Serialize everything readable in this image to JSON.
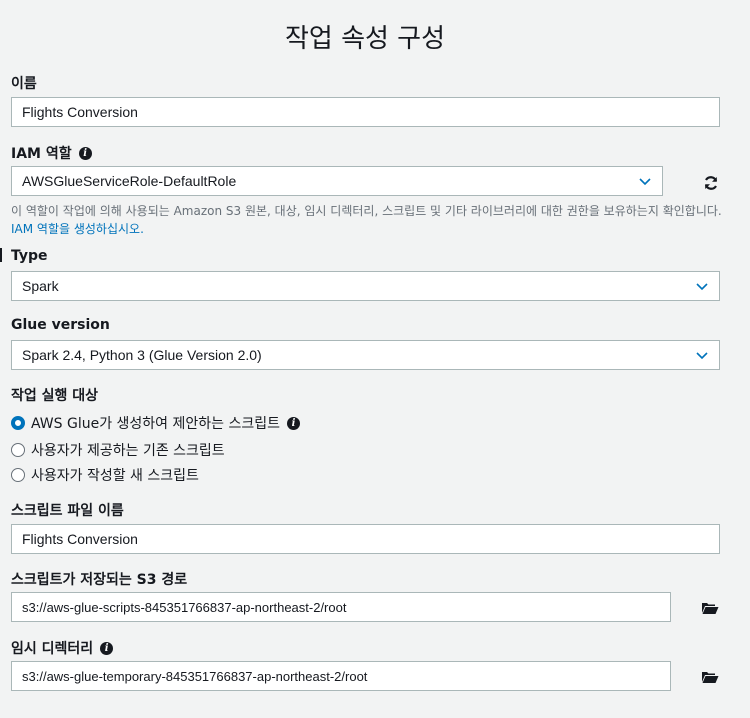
{
  "page": {
    "title": "작업 속성 구성"
  },
  "name": {
    "label": "이름",
    "value": "Flights Conversion"
  },
  "iam_role": {
    "label": "IAM 역할",
    "value": "AWSGlueServiceRole-DefaultRole",
    "help_text": "이 역할이 작업에 의해 사용되는 Amazon S3 원본, 대상, 임시 디렉터리, 스크립트 및 기타 라이브러리에 대한 권한을 보유하는지 확인합니다.",
    "help_link": "IAM 역할을 생성하십시오."
  },
  "type": {
    "label": "Type",
    "value": "Spark"
  },
  "glue_version": {
    "label": "Glue version",
    "value": "Spark 2.4, Python 3 (Glue Version 2.0)"
  },
  "run_target": {
    "label": "작업 실행 대상",
    "options": [
      {
        "label": "AWS Glue가 생성하여 제안하는 스크립트",
        "selected": true
      },
      {
        "label": "사용자가 제공하는 기존 스크립트",
        "selected": false
      },
      {
        "label": "사용자가 작성할 새 스크립트",
        "selected": false
      }
    ]
  },
  "script_file": {
    "label": "스크립트 파일 이름",
    "value": "Flights Conversion"
  },
  "script_path": {
    "label": "스크립트가 저장되는 S3 경로",
    "value": "s3://aws-glue-scripts-845351766837-ap-northeast-2/root"
  },
  "temp_dir": {
    "label": "임시 디렉터리",
    "value": "s3://aws-glue-temporary-845351766837-ap-northeast-2/root"
  },
  "colors": {
    "accent": "#0073bb",
    "border": "#aab7b8",
    "background": "#f2f3f3"
  }
}
